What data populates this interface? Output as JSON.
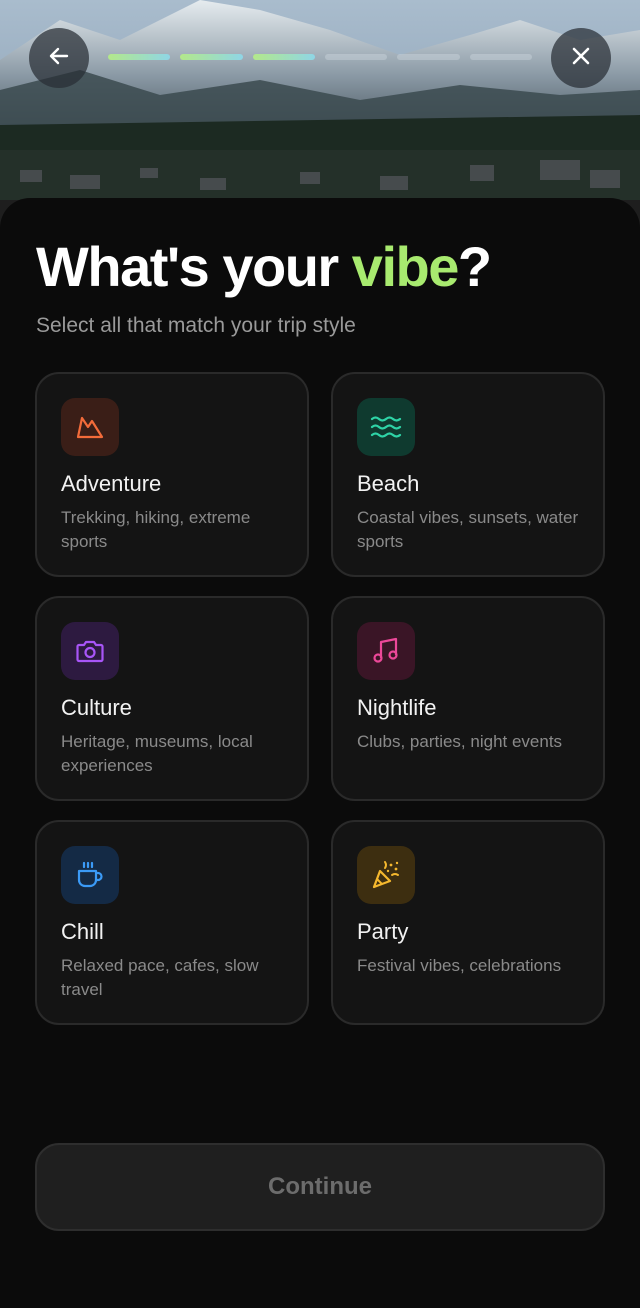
{
  "header": {
    "back_icon": "arrow-left-icon",
    "close_icon": "close-icon",
    "progress": {
      "total_steps": 6,
      "completed_steps": 3
    }
  },
  "main": {
    "title_prefix": "What's your ",
    "title_accent": "vibe",
    "title_suffix": "?",
    "subtitle": "Select all that match your trip style"
  },
  "vibes": [
    {
      "icon": "mountain-icon",
      "label": "Adventure",
      "description": "Trekking, hiking, extreme sports",
      "color": "#f26b3a",
      "icon_bg": "#3a1e17"
    },
    {
      "icon": "waves-icon",
      "label": "Beach",
      "description": "Coastal vibes, sunsets, water sports",
      "color": "#2ed3a6",
      "icon_bg": "#0f3a2f"
    },
    {
      "icon": "camera-icon",
      "label": "Culture",
      "description": "Heritage, museums, local experiences",
      "color": "#a855f7",
      "icon_bg": "#2d1a40"
    },
    {
      "icon": "music-note-icon",
      "label": "Nightlife",
      "description": "Clubs, parties, night events",
      "color": "#ec4899",
      "icon_bg": "#3a1526"
    },
    {
      "icon": "coffee-cup-icon",
      "label": "Chill",
      "description": "Relaxed pace, cafes, slow travel",
      "color": "#3b9af6",
      "icon_bg": "#142a45"
    },
    {
      "icon": "party-popper-icon",
      "label": "Party",
      "description": "Festival vibes, celebrations",
      "color": "#f5b82e",
      "icon_bg": "#3d2e10"
    }
  ],
  "footer": {
    "continue_label": "Continue"
  },
  "colors": {
    "accent": "#a8ea6f",
    "background": "#0b0b0b",
    "card": "#141414"
  }
}
